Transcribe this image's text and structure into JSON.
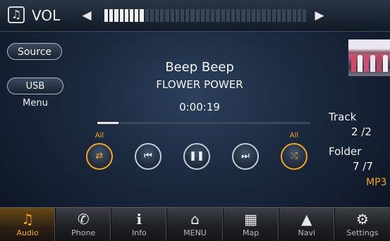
{
  "volume": {
    "label": "VOL",
    "level_fraction": 0.2,
    "icon": "music-note-icon",
    "down_icon": "triangle-left-icon",
    "up_icon": "triangle-right-icon"
  },
  "left_buttons": {
    "source_label": "Source",
    "usb_menu_label": "USB Menu"
  },
  "now_playing": {
    "title": "Beep Beep",
    "artist": "FLOWER POWER",
    "elapsed": "0:00:19",
    "progress_fraction": 0.1
  },
  "track_info": {
    "track_label": "Track",
    "track_value": "2 /2",
    "folder_label": "Folder",
    "folder_value": "7 /7",
    "format": "MP3"
  },
  "controls": {
    "repeat_mode": "All",
    "shuffle_mode": "All",
    "repeat_icon": "repeat-icon",
    "previous_icon": "skip-previous-icon",
    "pause_icon": "pause-icon",
    "next_icon": "skip-next-icon",
    "shuffle_icon": "shuffle-icon"
  },
  "nav": [
    {
      "label": "Audio",
      "icon": "music-note-icon",
      "active": true
    },
    {
      "label": "Phone",
      "icon": "phone-icon",
      "active": false
    },
    {
      "label": "Info",
      "icon": "info-icon",
      "active": false
    },
    {
      "label": "MENU",
      "icon": "home-icon",
      "active": false
    },
    {
      "label": "Map",
      "icon": "map-icon",
      "active": false
    },
    {
      "label": "Navi",
      "icon": "navigation-arrow-icon",
      "active": false
    },
    {
      "label": "Settings",
      "icon": "gear-icon",
      "active": false
    }
  ],
  "colors": {
    "accent": "#f4a623",
    "background": "#1c2a40"
  }
}
